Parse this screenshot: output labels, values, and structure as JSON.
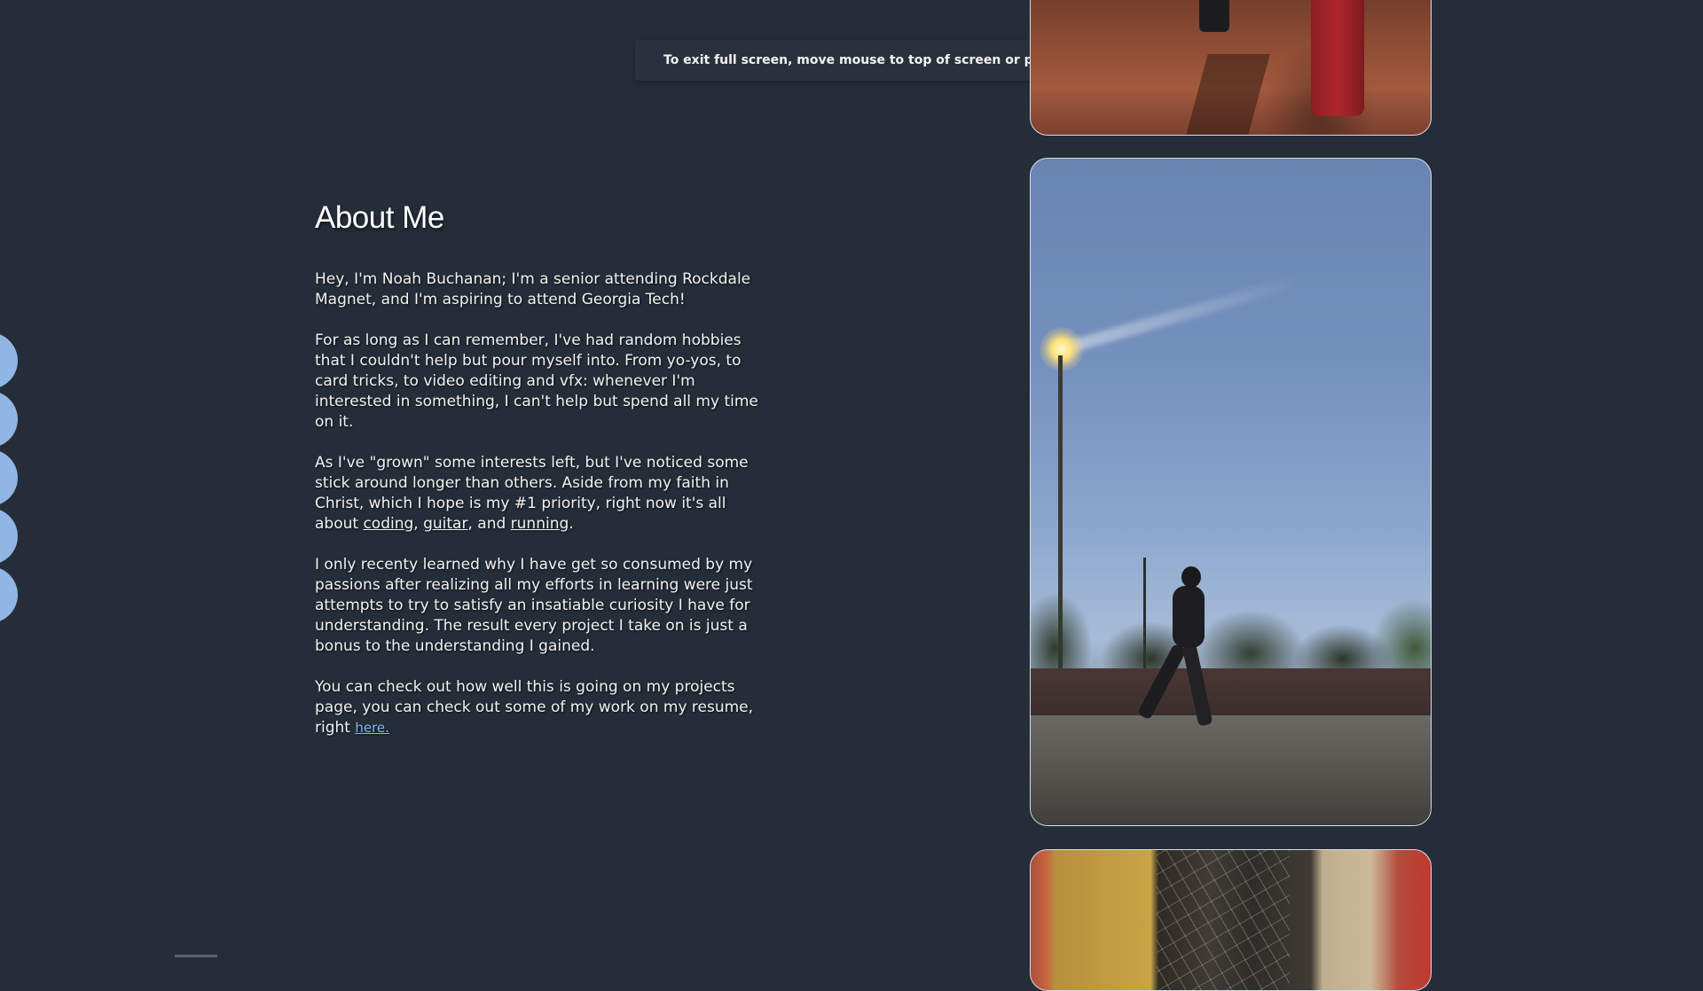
{
  "fullscreen_notice": {
    "text": "To exit full screen, move mouse to top of screen or press",
    "key": "F11"
  },
  "about": {
    "title": "About Me",
    "p1": "Hey, I'm Noah Buchanan; I'm a senior attending Rockdale Magnet, and I'm aspiring to attend Georgia Tech!",
    "p2": "For as long as I can remember, I've had random hobbies that I couldn't help but pour myself into. From yo-yos, to card tricks, to video editing and vfx: whenever I'm interested in something, I can't help but spend all my time on it.",
    "p3_before": "As I've \"grown\" some interests left, but I've noticed some stick around longer than others. Aside from my faith in Christ, which I hope is my #1 priority, right now it's all about ",
    "link_coding": "coding",
    "sep1": ", ",
    "link_guitar": "guitar",
    "sep2": ", and ",
    "link_running": "running",
    "p3_after": ".",
    "p4": "I only recenty learned why I have get so consumed by my passions after realizing all my efforts in learning were just attempts to try to satisfy an insatiable curiosity I have for understanding. The result every project I take on is just a bonus to the understanding I gained.",
    "p5_before": "You can check out how well this is going on my projects page, you can check out some of my work on my resume, right ",
    "link_here": "here."
  },
  "side_bubble_count": 5,
  "colors": {
    "background": "#252d39",
    "side_bubble": "#8fb6e5",
    "link_accent": "#8ab7ec"
  },
  "photos": [
    {
      "subject": "red-pants-pavement-photo"
    },
    {
      "subject": "night-runner-photo"
    },
    {
      "subject": "stained-glass-church-photo"
    }
  ]
}
